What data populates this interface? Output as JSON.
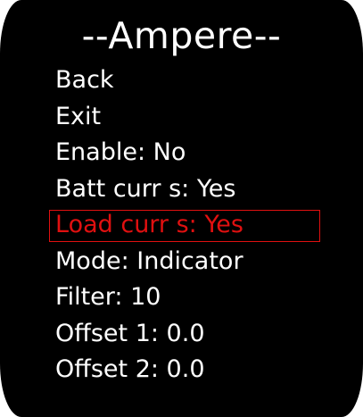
{
  "screen": {
    "title": "--Ampere--"
  },
  "menu": {
    "items": [
      {
        "label": "Back"
      },
      {
        "label": "Exit"
      },
      {
        "label": "Enable: No"
      },
      {
        "label": "Batt curr s: Yes"
      },
      {
        "label": "Load curr s: Yes"
      },
      {
        "label": "Mode: Indicator"
      },
      {
        "label": "Filter: 10"
      },
      {
        "label": "Offset 1: 0.0"
      },
      {
        "label": "Offset 2: 0.0"
      }
    ],
    "selected_item": "Load curr s: Yes"
  },
  "colors": {
    "background": "#000000",
    "text": "#ffffff",
    "highlight": "#e01010"
  }
}
